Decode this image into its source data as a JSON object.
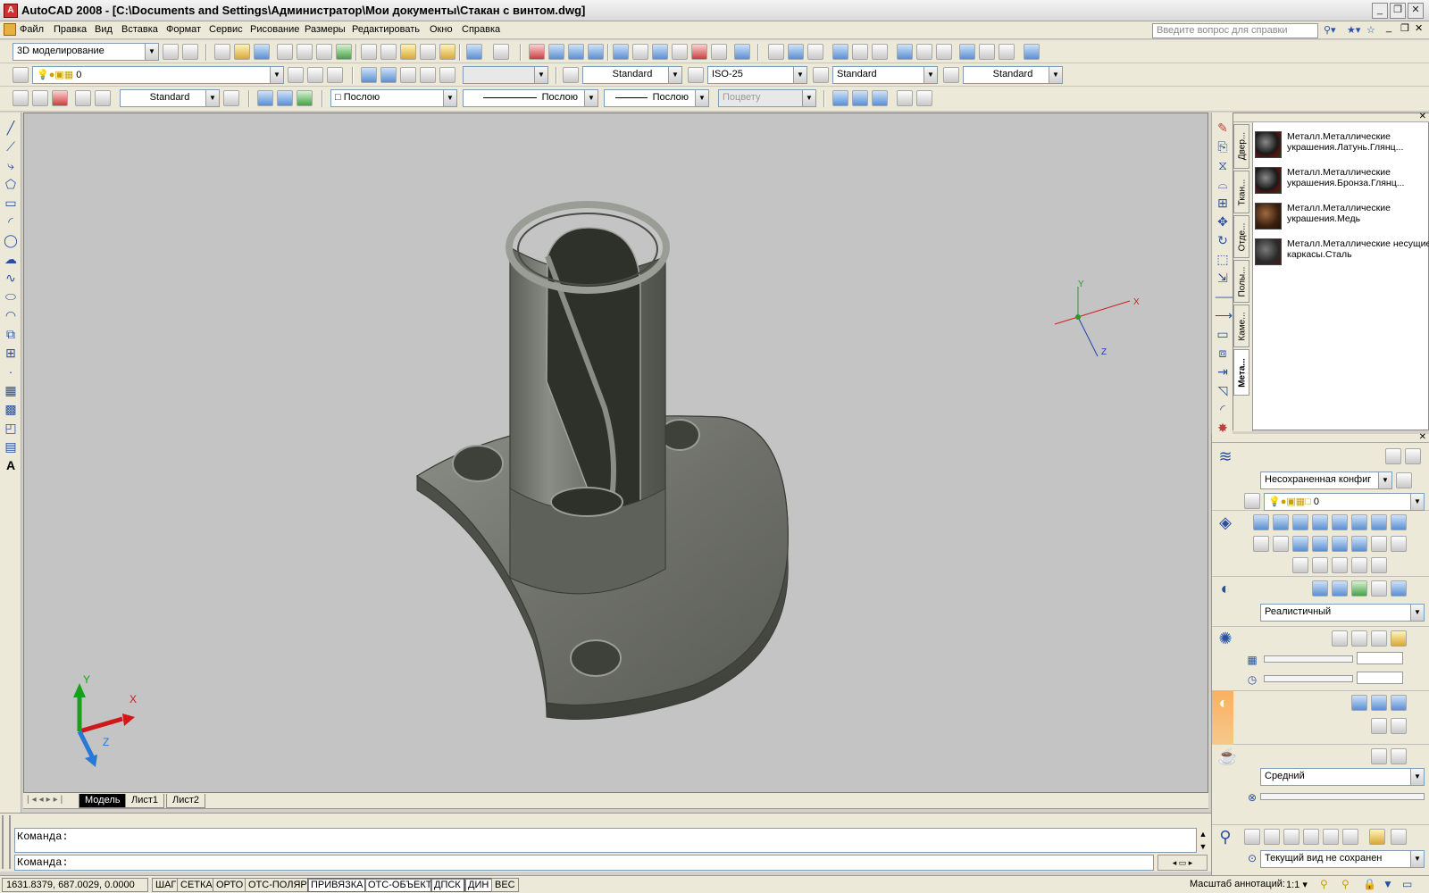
{
  "window": {
    "title": "AutoCAD 2008 - [C:\\Documents and Settings\\Администратор\\Мои документы\\Стакан с винтом.dwg]"
  },
  "menu": [
    "Файл",
    "Правка",
    "Вид",
    "Вставка",
    "Формат",
    "Сервис",
    "Рисование",
    "Размеры",
    "Редактировать",
    "Окно",
    "Справка"
  ],
  "help_placeholder": "Введите вопрос для справки",
  "toolbars": {
    "workspace": "3D моделирование",
    "layer": "0",
    "text_style": "Standard",
    "dim_style": "ISO-25",
    "table_style": "Standard",
    "mleader_style": "Standard",
    "ucs_style": "Standard",
    "color": "Послою",
    "linetype": "Послою",
    "lineweight": "Послою",
    "plotstyle": "Поцвету"
  },
  "layout_tabs": [
    "Модель",
    "Лист1",
    "Лист2"
  ],
  "active_layout": "Модель",
  "ucs_viewport": {
    "x": "X",
    "y": "Y",
    "z": "Z"
  },
  "ucs_icon": {
    "x": "X",
    "y": "Y",
    "z": "Z"
  },
  "palette_tabs": [
    "Двер...",
    "Ткан...",
    "Отде...",
    "Полы...",
    "Каме...",
    "Мета..."
  ],
  "materials": [
    {
      "name": "Металл.Металлические украшения.Латунь.Глянц..."
    },
    {
      "name": "Металл.Металлические украшения.Бронза.Глянц..."
    },
    {
      "name": "Металл.Металлические украшения.Медь"
    },
    {
      "name": "Металл.Металлические несущие каркасы.Сталь"
    }
  ],
  "dashboard": {
    "layer_state": "Несохраненная конфиг",
    "layer": "0",
    "visual_style": "Реалистичный",
    "render_quality": "Средний",
    "named_view": "Текущий вид не сохранен"
  },
  "command": {
    "prompt1": "Команда:",
    "prompt2": "Команда:"
  },
  "status": {
    "coords": "1631.8379, 687.0029, 0.0000",
    "buttons": [
      "ШАГ",
      "СЕТКА",
      "ОРТО",
      "ОТС-ПОЛЯР",
      "ПРИВЯЗКА",
      "ОТС-ОБЪЕКТ",
      "ДПСК",
      "ДИН",
      "ВЕС"
    ],
    "annot_label": "Масштаб аннотаций:",
    "annot_value": "1:1"
  },
  "colors": {
    "viewport": "#c4c4c4",
    "model": "#6f716a",
    "chrome": "#ece9d8"
  }
}
